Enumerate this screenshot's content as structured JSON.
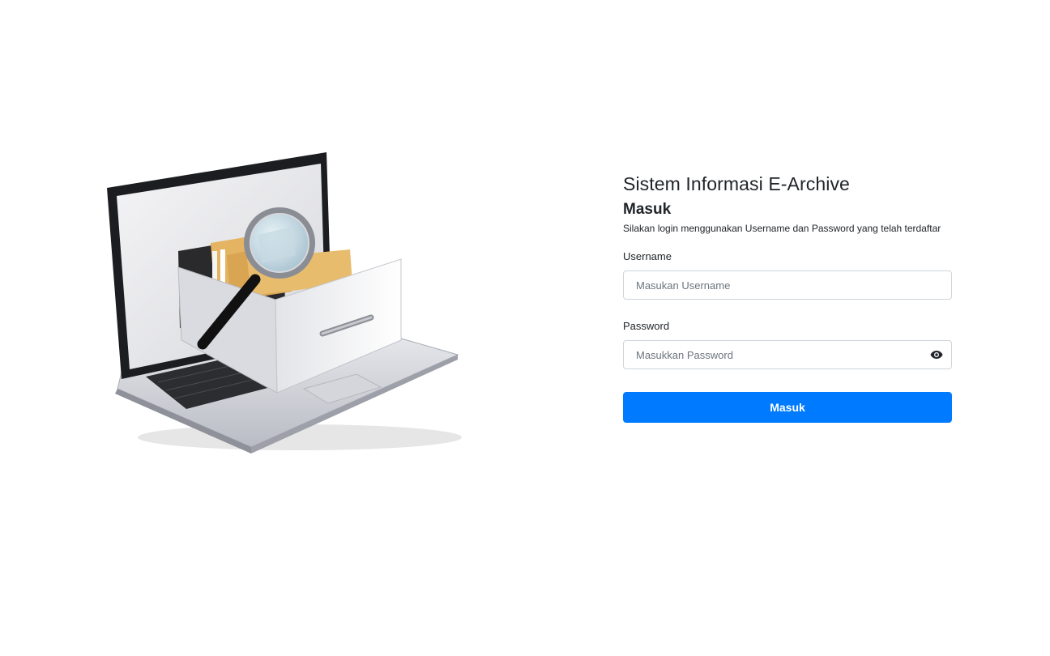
{
  "app": {
    "title": "Sistem Informasi E-Archive"
  },
  "illustration": {
    "icon": "laptop-file-cabinet-magnifier-illustration"
  },
  "login_form": {
    "heading": "Masuk",
    "subtitle": "Silakan login menggunakan Username dan Password yang telah terdaftar",
    "username": {
      "label": "Username",
      "placeholder": "Masukan Username",
      "value": ""
    },
    "password": {
      "label": "Password",
      "placeholder": "Masukkan Password",
      "value": "",
      "toggle_icon": "eye-icon"
    },
    "submit_label": "Masuk"
  },
  "colors": {
    "primary": "#007bff",
    "text": "#212529",
    "input_border": "#ced4da",
    "placeholder": "#6c757d"
  }
}
